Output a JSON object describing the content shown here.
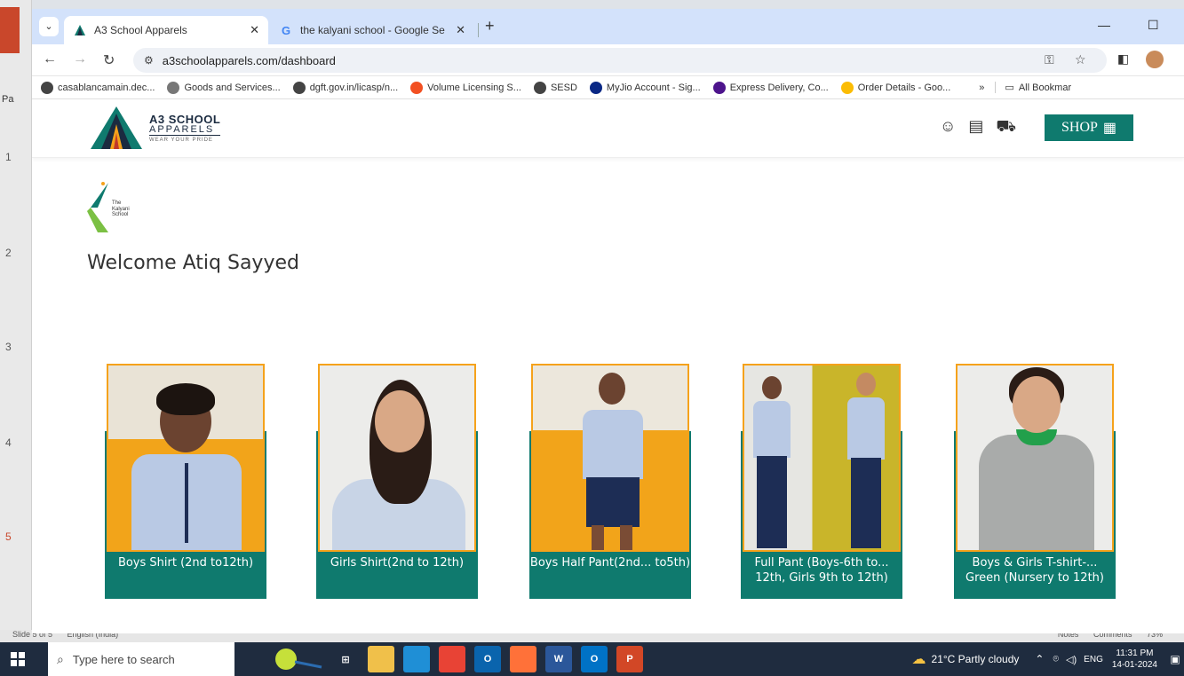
{
  "ppt": {
    "left_label": "Pa",
    "slide_numbers": [
      "1",
      "2",
      "3",
      "4",
      "5"
    ],
    "status_left": [
      "Slide 5 of 5",
      "English (India)"
    ],
    "status_right": [
      "Notes",
      "Comments",
      "73%"
    ]
  },
  "browser": {
    "tabs": [
      {
        "title": "A3 School Apparels",
        "favicon": "a3-logo-icon",
        "active": true
      },
      {
        "title": "the kalyani school - Google Se",
        "favicon": "google-icon",
        "active": false
      }
    ],
    "url": "a3schoolapparels.com/dashboard",
    "bookmarks": [
      {
        "label": "casablancamain.dec...",
        "icon": "globe-icon",
        "color": "#444444"
      },
      {
        "label": "Goods and Services...",
        "icon": "emblem-icon",
        "color": "#777777"
      },
      {
        "label": "dgft.gov.in/licasp/n...",
        "icon": "globe-icon",
        "color": "#444444"
      },
      {
        "label": "Volume Licensing S...",
        "icon": "microsoft-icon",
        "color": "#f25022"
      },
      {
        "label": "SESD",
        "icon": "globe-icon",
        "color": "#444444"
      },
      {
        "label": "MyJio Account - Sig...",
        "icon": "jio-icon",
        "color": "#0a2885"
      },
      {
        "label": "Express Delivery, Co...",
        "icon": "fedex-icon",
        "color": "#4d148c"
      },
      {
        "label": "Order Details - Goo...",
        "icon": "drive-icon",
        "color": "#fbbc04"
      }
    ],
    "bookmarks_more": "»",
    "all_bookmarks": "All Bookmar"
  },
  "site": {
    "logo": {
      "line1": "A3 SCHOOL",
      "line2": "APPARELS",
      "line3": "WEAR YOUR PRIDE"
    },
    "shop_label": "SHOP",
    "school_logo": {
      "line1": "The",
      "line2": "Kalyani",
      "line3": "School"
    },
    "welcome": "Welcome Atiq Sayyed",
    "products": [
      {
        "label": "Boys Shirt (2nd to12th)"
      },
      {
        "label": "Girls Shirt(2nd to 12th)"
      },
      {
        "label": "Boys Half Pant(2nd... to5th)"
      },
      {
        "label": "Full Pant (Boys-6th to... 12th, Girls 9th to 12th)"
      },
      {
        "label": "Boys & Girls T-shirt-... Green (Nursery to 12th)"
      }
    ]
  },
  "taskbar": {
    "search_placeholder": "Type here to search",
    "weather": "21°C  Partly cloudy",
    "lang": "ENG",
    "time": "11:31 PM",
    "date": "14-01-2024",
    "apps": [
      {
        "name": "task-view-icon",
        "text": "⊞",
        "color": "#1f2c3f"
      },
      {
        "name": "file-explorer-icon",
        "text": "",
        "color": "#f0c04a"
      },
      {
        "name": "edge-icon",
        "text": "",
        "color": "#1f8fd6"
      },
      {
        "name": "chrome-icon",
        "text": "",
        "color": "#e84335"
      },
      {
        "name": "outlook-icon",
        "text": "O",
        "color": "#0a64ad"
      },
      {
        "name": "firefox-icon",
        "text": "",
        "color": "#ff7139"
      },
      {
        "name": "word-icon",
        "text": "W",
        "color": "#2b579a"
      },
      {
        "name": "outlook2-icon",
        "text": "O",
        "color": "#0072c6"
      },
      {
        "name": "powerpoint-icon",
        "text": "P",
        "color": "#d24726"
      }
    ]
  }
}
